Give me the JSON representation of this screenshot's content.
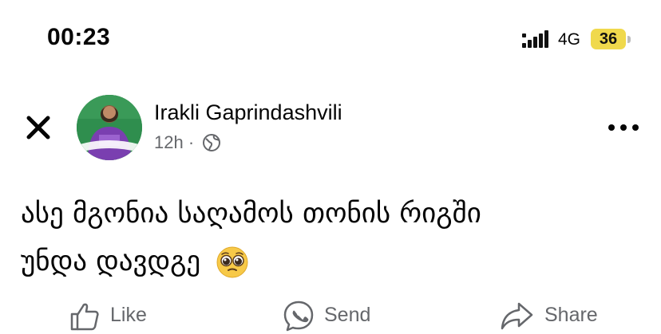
{
  "status_bar": {
    "time": "00:23",
    "network": "4G",
    "battery": "36"
  },
  "post": {
    "author": "Irakli Gaprindashvili",
    "timestamp": "12h",
    "separator": "·",
    "privacy_icon": "globe-icon",
    "text_line1": "ასე მგონია საღამოს თონის რიგში",
    "text_line2": "უნდა დავდგე",
    "emoji": "pleading-face-emoji"
  },
  "actions": {
    "like": "Like",
    "send": "Send",
    "share": "Share"
  },
  "colors": {
    "text": "#050505",
    "secondary": "#65676b",
    "battery": "#f0d94c"
  }
}
